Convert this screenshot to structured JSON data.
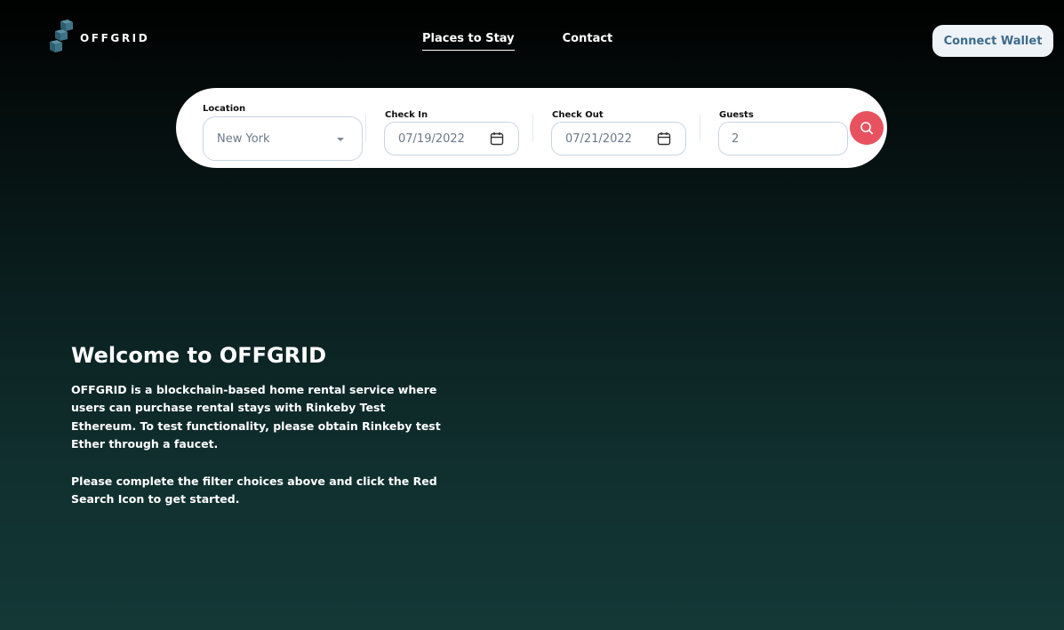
{
  "header": {
    "logo_text": "OFFGRID",
    "nav": [
      {
        "label": "Places to Stay",
        "active": true
      },
      {
        "label": "Contact",
        "active": false
      }
    ],
    "connect_wallet_label": "Connect Wallet"
  },
  "search": {
    "location": {
      "label": "Location",
      "value": "New York"
    },
    "check_in": {
      "label": "Check In",
      "value": "07/19/2022"
    },
    "check_out": {
      "label": "Check Out",
      "value": "07/21/2022"
    },
    "guests": {
      "label": "Guests",
      "value": "2"
    }
  },
  "welcome": {
    "title": "Welcome to OFFGRID",
    "paragraph_1": "OFFGRID is a blockchain-based home rental service where users can purchase rental stays with Rinkeby Test Ethereum. To test functionality, please obtain Rinkeby test Ether through a faucet.",
    "paragraph_2": "Please complete the filter choices above and click the Red Search Icon to get started."
  },
  "colors": {
    "accent_red": "#e8525f",
    "wallet_button_bg": "#eef3f8",
    "wallet_button_text": "#3d6b8a",
    "logo_cube": "#3a6b7e"
  }
}
